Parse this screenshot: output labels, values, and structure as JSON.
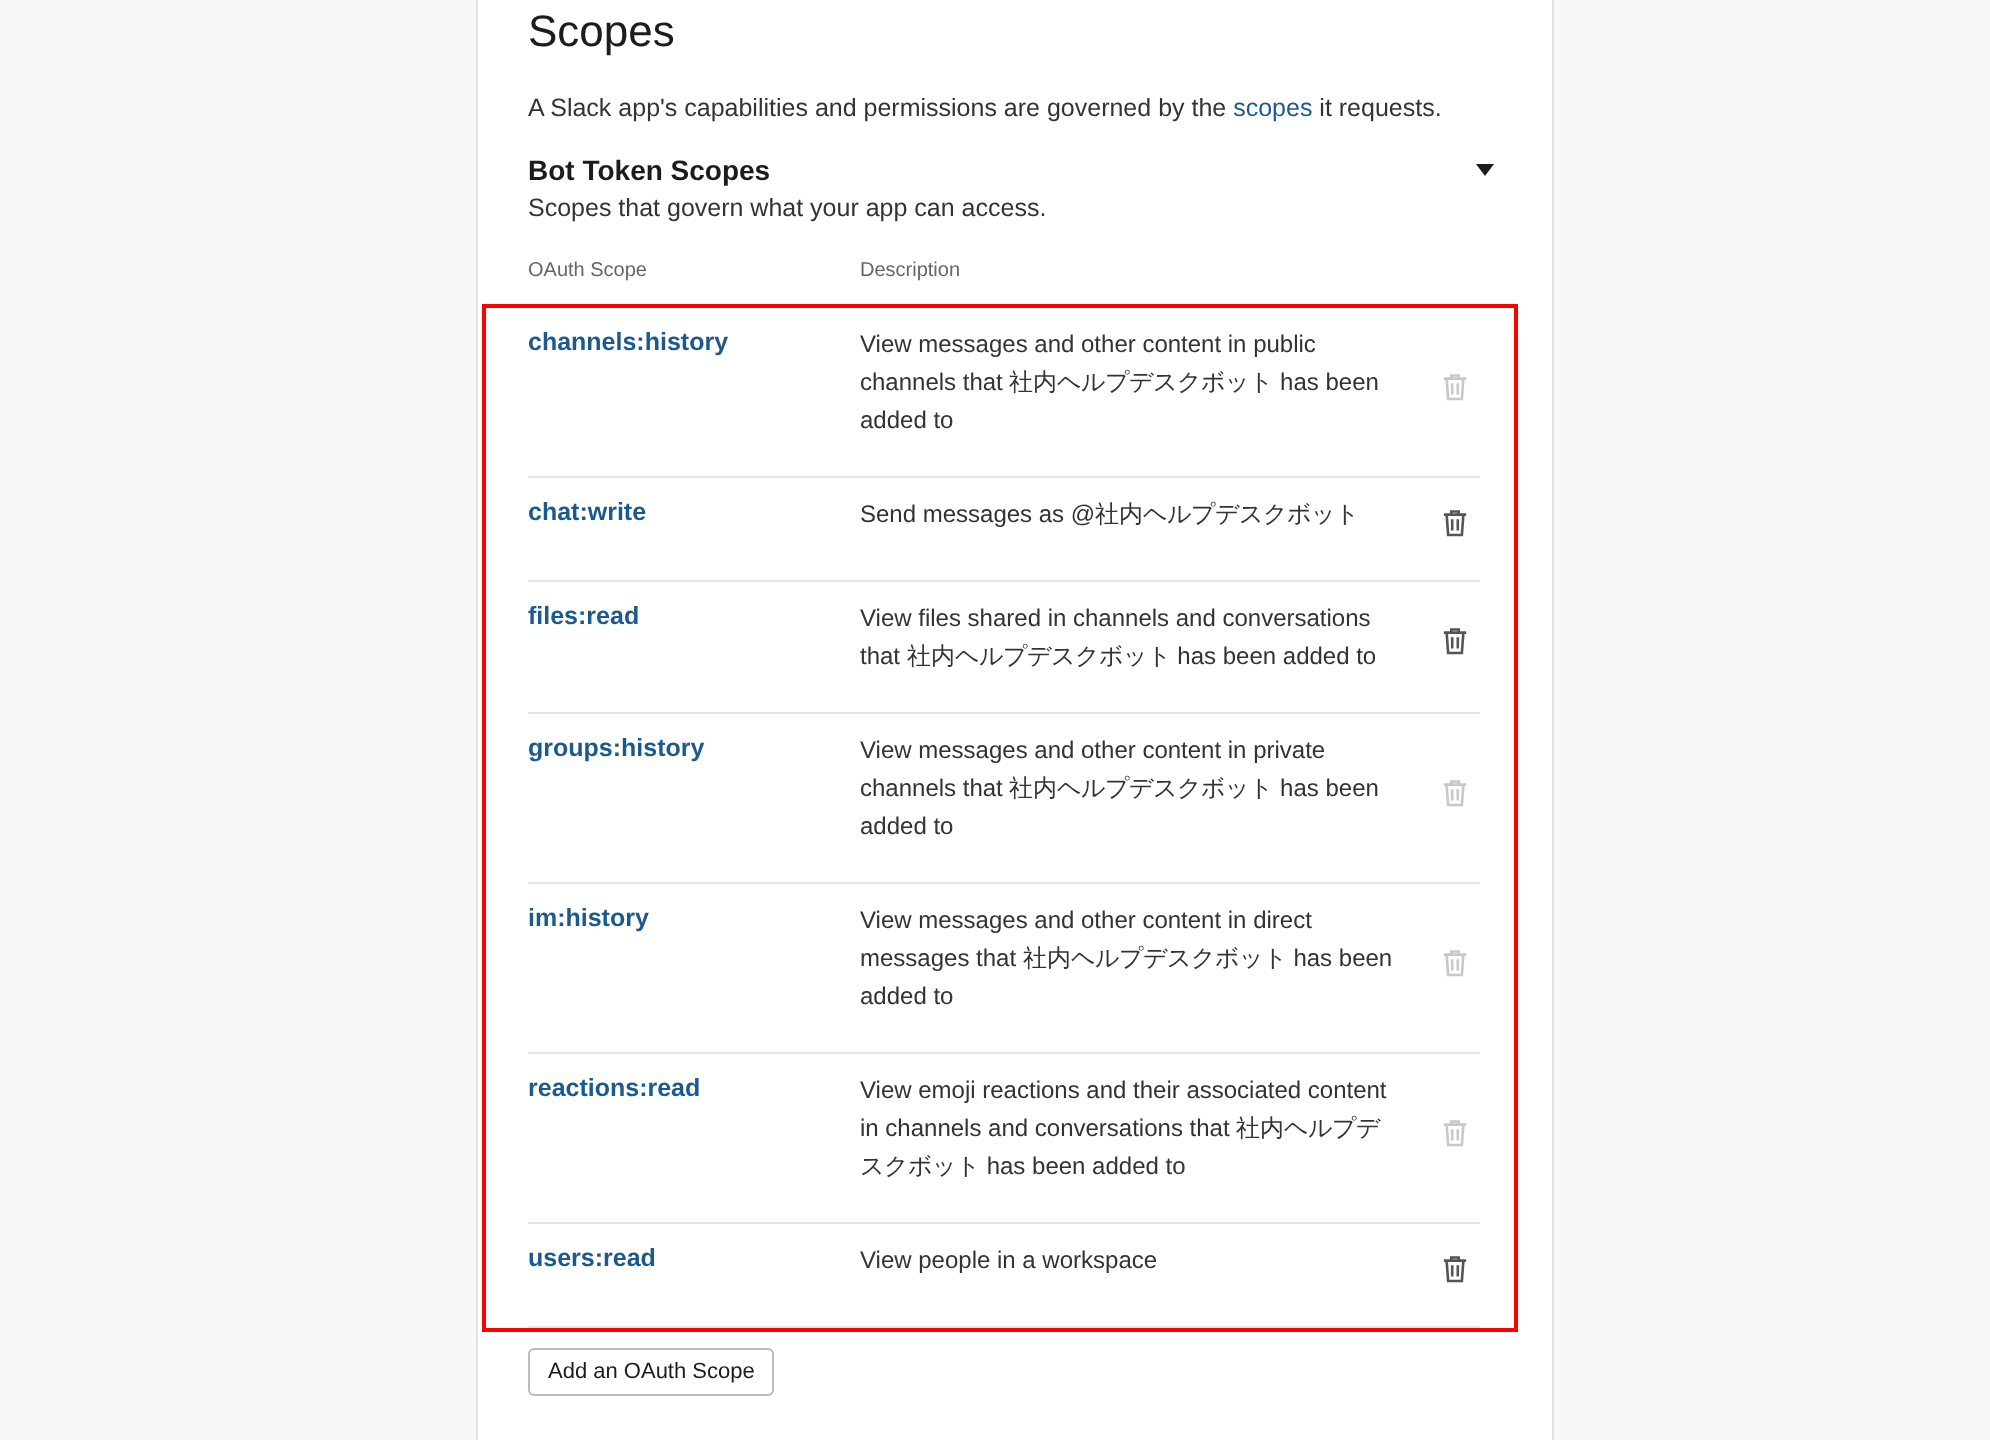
{
  "title": "Scopes",
  "intro": {
    "before": "A Slack app's capabilities and permissions are governed by the ",
    "link": "scopes",
    "after": " it requests."
  },
  "section": {
    "title": "Bot Token Scopes",
    "subtitle": "Scopes that govern what your app can access.",
    "expanded": true
  },
  "columns": [
    "OAuth Scope",
    "Description"
  ],
  "scopes": [
    {
      "name": "channels:history",
      "description": "View messages and other content in public channels that 社内ヘルプデスクボット has been added to",
      "removable": false
    },
    {
      "name": "chat:write",
      "description": "Send messages as @社内ヘルプデスクボット",
      "removable": true
    },
    {
      "name": "files:read",
      "description": "View files shared in channels and conversations that 社内ヘルプデスクボット has been added to",
      "removable": true
    },
    {
      "name": "groups:history",
      "description": "View messages and other content in private channels that 社内ヘルプデスクボット has been added to",
      "removable": false
    },
    {
      "name": "im:history",
      "description": "View messages and other content in direct messages that 社内ヘルプデスクボット has been added to",
      "removable": false
    },
    {
      "name": "reactions:read",
      "description": "View emoji reactions and their associated content in channels and conversations that 社内ヘルプデスクボット has been added to",
      "removable": false
    },
    {
      "name": "users:read",
      "description": "View people in a workspace",
      "removable": true
    }
  ],
  "add_button": "Add an OAuth Scope"
}
